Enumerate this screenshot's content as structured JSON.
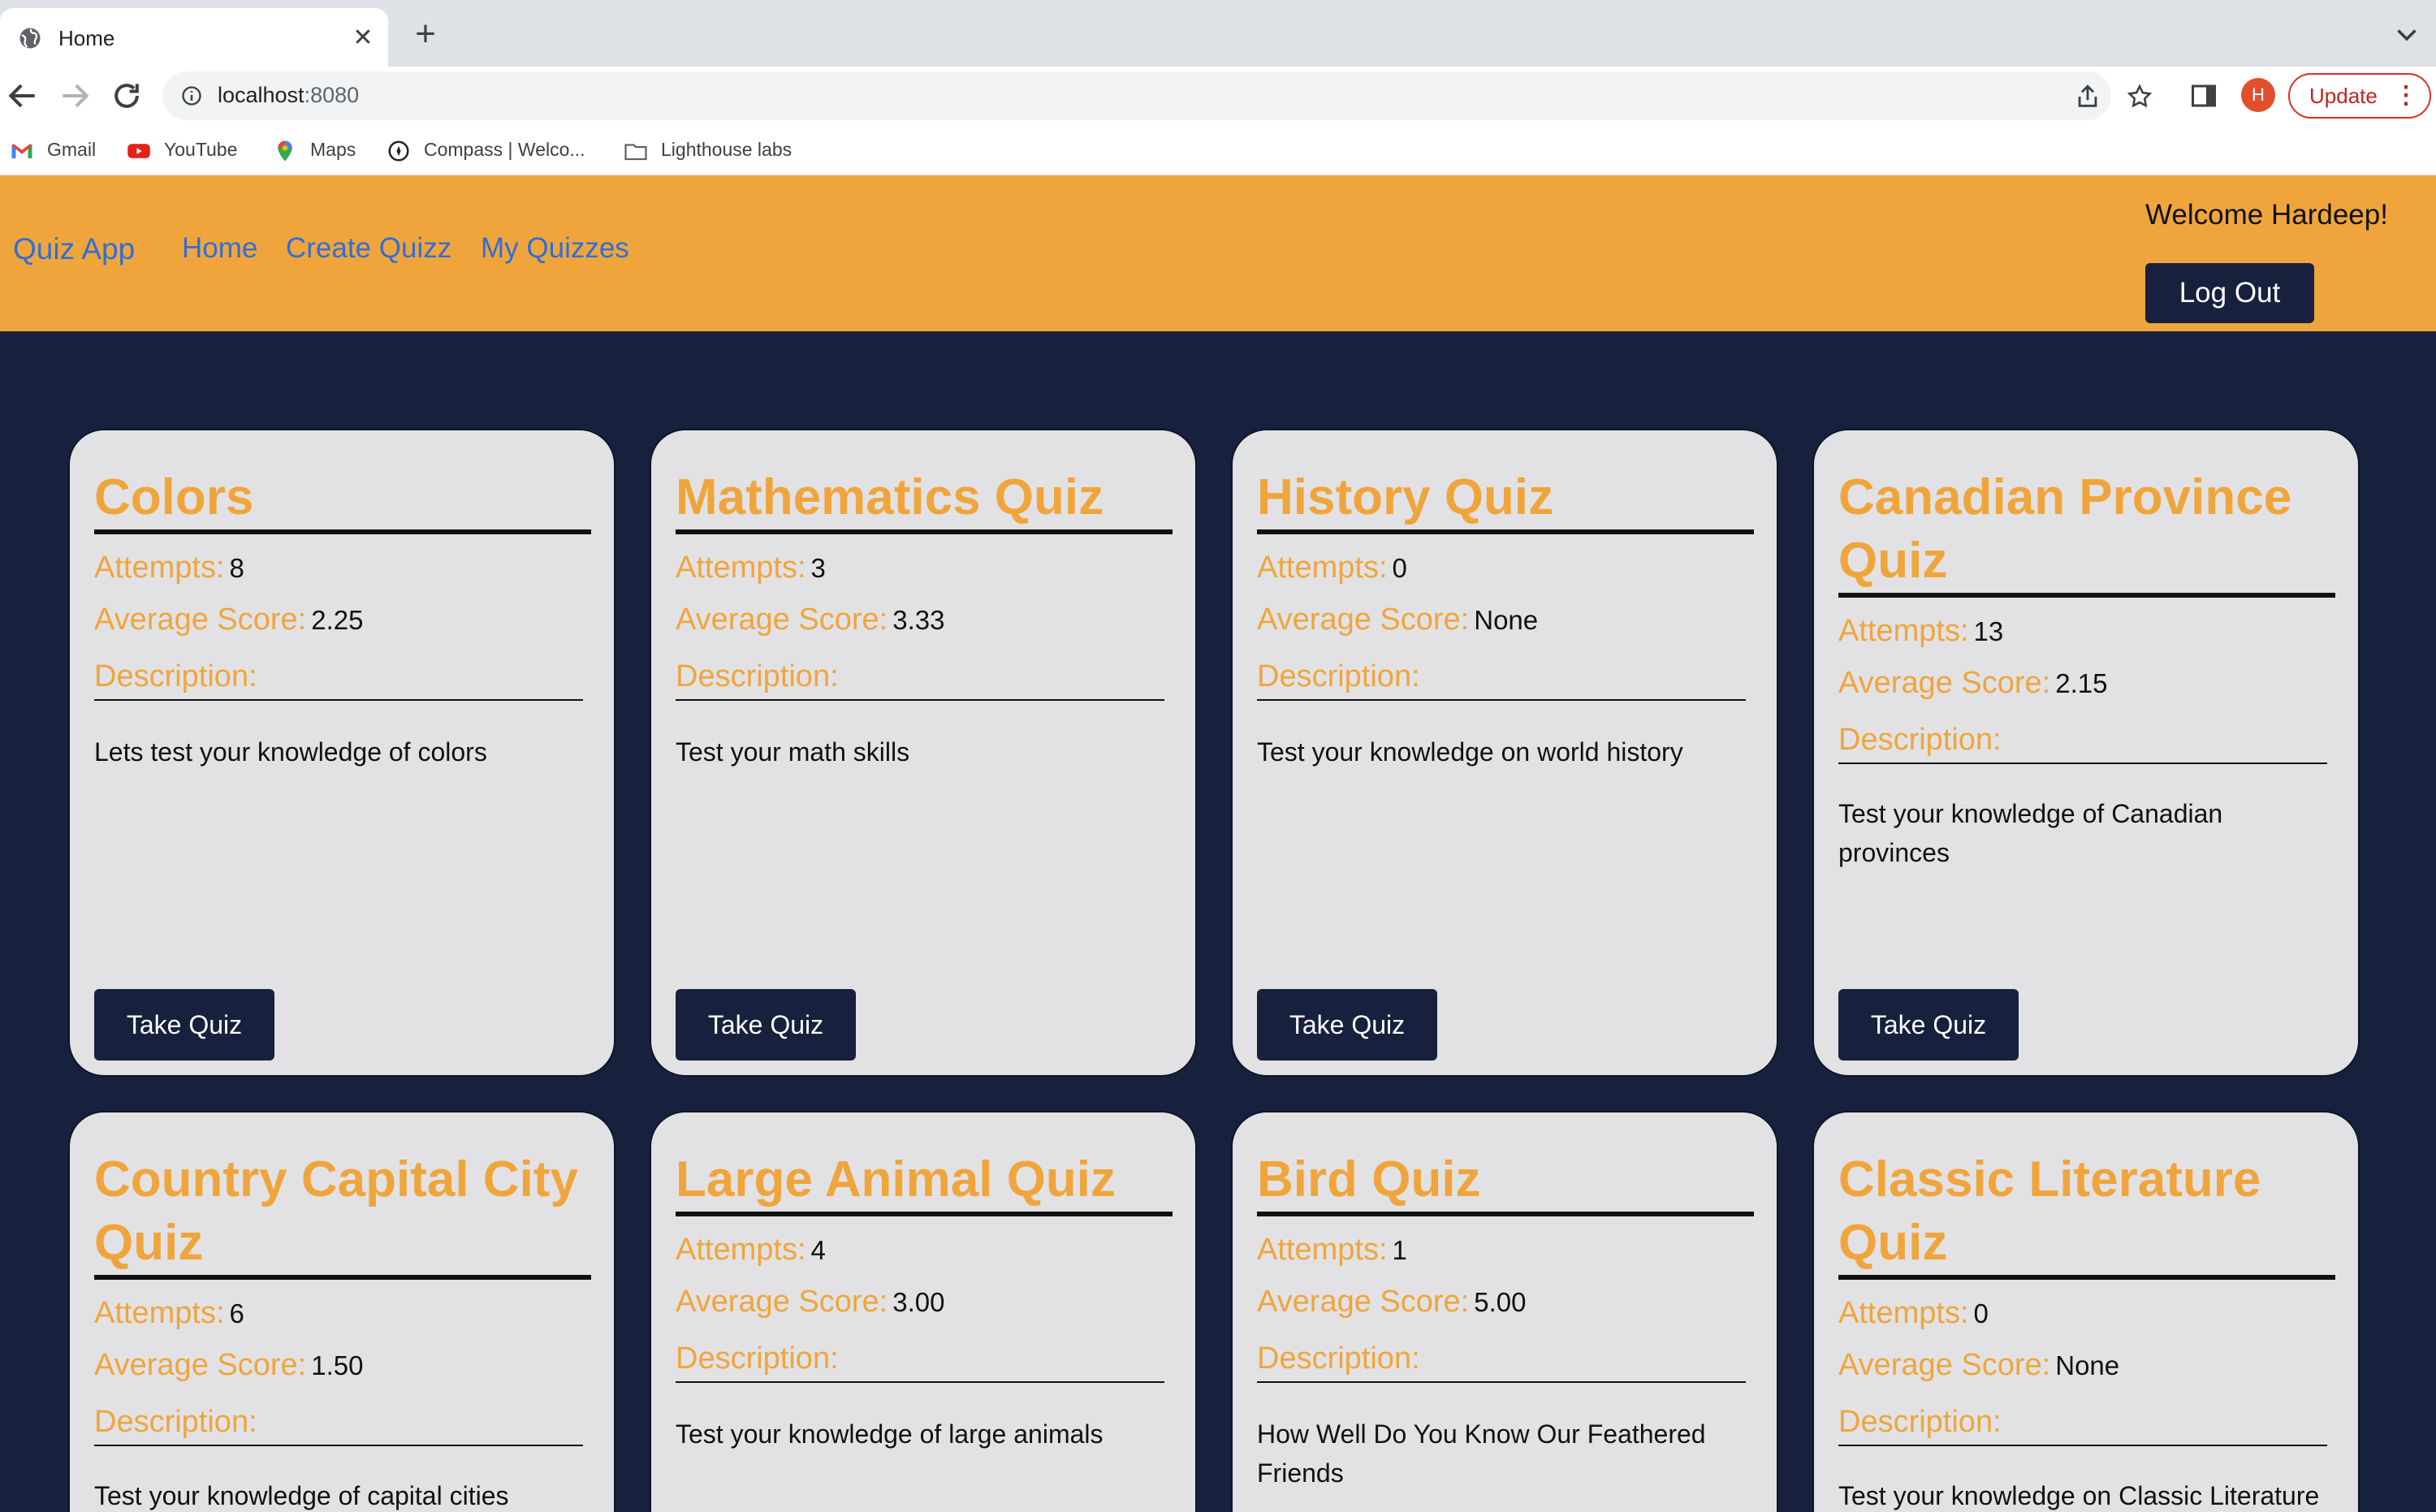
{
  "browser": {
    "tab_title": "Home",
    "url_host": "localhost",
    "url_port": ":8080",
    "avatar_initial": "H",
    "update_label": "Update",
    "bookmarks": [
      {
        "label": "Gmail",
        "icon": "gmail-icon"
      },
      {
        "label": "YouTube",
        "icon": "youtube-icon"
      },
      {
        "label": "Maps",
        "icon": "maps-icon"
      },
      {
        "label": "Compass | Welco...",
        "icon": "compass-icon"
      },
      {
        "label": "Lighthouse labs",
        "icon": "folder-icon"
      }
    ]
  },
  "header": {
    "brand": "Quiz App",
    "nav": [
      "Home",
      "Create Quizz",
      "My Quizzes"
    ],
    "welcome": "Welcome Hardeep!",
    "logout_label": "Log Out",
    "background_color": "#f0a53c",
    "link_color": "#2f6fd6"
  },
  "labels": {
    "attempts": "Attempts:",
    "average_score": "Average Score:",
    "description": "Description:",
    "take_quiz": "Take Quiz"
  },
  "quizzes": [
    {
      "title": "Colors",
      "attempts": "8",
      "average_score": "2.25",
      "description": "Lets test your knowledge of colors"
    },
    {
      "title": "Mathematics Quiz",
      "attempts": "3",
      "average_score": "3.33",
      "description": "Test your math skills"
    },
    {
      "title": "History Quiz",
      "attempts": "0",
      "average_score": "None",
      "description": "Test your knowledge on world history"
    },
    {
      "title": "Canadian Province Quiz",
      "attempts": "13",
      "average_score": "2.15",
      "description": "Test your knowledge of Canadian provinces"
    },
    {
      "title": "Country Capital City Quiz",
      "attempts": "6",
      "average_score": "1.50",
      "description": "Test your knowledge of capital cities"
    },
    {
      "title": "Large Animal Quiz",
      "attempts": "4",
      "average_score": "3.00",
      "description": "Test your knowledge of large animals"
    },
    {
      "title": "Bird Quiz",
      "attempts": "1",
      "average_score": "5.00",
      "description": "How Well Do You Know Our Feathered Friends"
    },
    {
      "title": "Classic Literature Quiz",
      "attempts": "0",
      "average_score": "None",
      "description": "Test your knowledge on Classic Literature"
    }
  ],
  "colors": {
    "page_background": "#17213d",
    "card_background": "#e2e2e4",
    "accent": "#f0a53c"
  }
}
